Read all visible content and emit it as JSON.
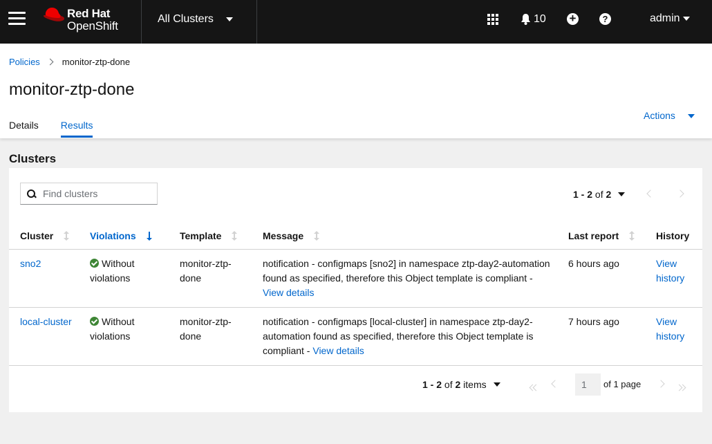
{
  "masthead": {
    "brand_line1": "Red Hat",
    "brand_line2": "OpenShift",
    "cluster_switcher": "All Clusters",
    "notification_count": "10",
    "user": "admin"
  },
  "breadcrumb": {
    "parent": "Policies",
    "current": "monitor-ztp-done"
  },
  "page": {
    "title": "monitor-ztp-done",
    "actions_label": "Actions",
    "tabs": [
      {
        "label": "Details",
        "active": false
      },
      {
        "label": "Results",
        "active": true
      }
    ]
  },
  "clusters": {
    "section_title": "Clusters",
    "search_placeholder": "Find clusters",
    "top_pager": {
      "range": "1 - 2",
      "of": "of",
      "total": "2"
    },
    "columns": [
      "Cluster",
      "Violations",
      "Template",
      "Message",
      "Last report",
      "History"
    ],
    "sorted_column": "Violations",
    "rows": [
      {
        "cluster": "sno2",
        "violations": "Without violations",
        "template": "monitor-ztp-done",
        "message": "notification - configmaps [sno2] in namespace ztp-day2-automation found as specified, therefore this Object template is compliant - ",
        "message_link": "View details",
        "last_report": "6 hours ago",
        "history": "View history"
      },
      {
        "cluster": "local-cluster",
        "violations": "Without violations",
        "template": "monitor-ztp-done",
        "message": "notification - configmaps [local-cluster] in namespace ztp-day2-automation found as specified, therefore this Object template is compliant - ",
        "message_link": "View details",
        "last_report": "7 hours ago",
        "history": "View history"
      }
    ],
    "bottom_pager": {
      "range": "1 - 2",
      "of": "of",
      "total": "2",
      "items_label": "items",
      "current_page": "1",
      "of_pages": "of 1 page"
    }
  },
  "colors": {
    "masthead_bg": "#151515",
    "link": "#0066cc",
    "success": "#3e8635",
    "page_bg": "#f0f0f0"
  },
  "icons": [
    "hamburger-icon",
    "redhat-logo",
    "caret-down-icon",
    "app-launcher-icon",
    "bell-icon",
    "plus-circle-icon",
    "question-circle-icon",
    "chevron-right-icon",
    "search-icon",
    "sort-icon",
    "check-circle-icon",
    "angle-left-icon",
    "angle-right-icon",
    "angle-double-left-icon",
    "angle-double-right-icon"
  ]
}
